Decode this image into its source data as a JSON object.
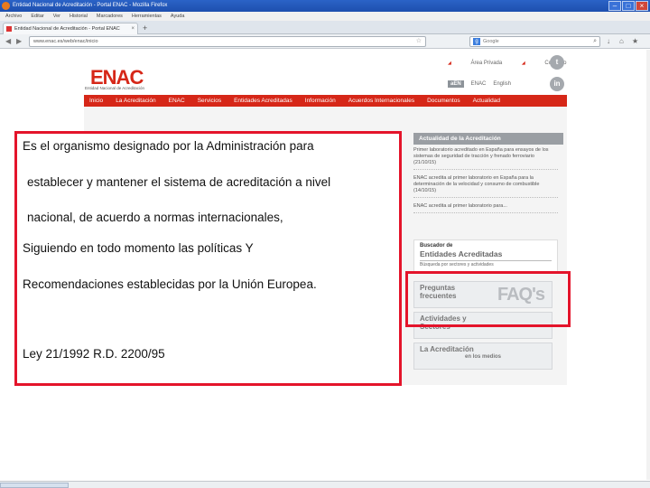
{
  "window": {
    "title": "Entidad Nacional de Acreditación - Portal ENAC - Mozilla Firefox",
    "min": "–",
    "max": "□",
    "close": "×"
  },
  "menubar": {
    "items": [
      "Archivo",
      "Editar",
      "Ver",
      "Historial",
      "Marcadores",
      "Herramientas",
      "Ayuda"
    ]
  },
  "tab": {
    "label": "Entidad Nacional de Acreditación - Portal ENAC",
    "close": "×",
    "new_tab": "+"
  },
  "navbar": {
    "back": "◀",
    "forward": "▶",
    "url": "www.enac.es/web/enac/inicio",
    "search_placeholder": "Google",
    "star": "☆",
    "search_glyph": "⌕"
  },
  "site": {
    "logo": "ENAC",
    "logo_sub": "Entidad Nacional de Acreditación",
    "top_links": [
      "Área Privada",
      "Contacto"
    ],
    "badges": [
      "aEN",
      "ENAC",
      "English"
    ],
    "social": [
      "t",
      "in"
    ],
    "nav": [
      "Inicio",
      "La Acreditación",
      "ENAC",
      "Servicios",
      "Entidades Acreditadas",
      "Información",
      "Acuerdos Internacionales",
      "Documentos",
      "Actualidad"
    ],
    "news_header": "Actualidad de la Acreditación",
    "news": [
      "Primer laboratorio acreditado en España para ensayos de los sistemas de seguridad de tracción y frenado ferroviario (21/10/15)",
      "ENAC acredita al primer laboratorio en España para la determinación de la velocidad y consumo de combustible (14/10/15)",
      "ENAC acredita al primer laboratorio para..."
    ],
    "buscador": {
      "line1": "Buscador de",
      "line2": "Entidades Acreditadas",
      "line3": "Búsqueda por sectores y actividades"
    },
    "banners": [
      {
        "l1": "Preguntas",
        "l2": "frecuentes",
        "side": "FAQ's"
      },
      {
        "l1": "Actividades y",
        "l2": "Sectores",
        "side": ""
      },
      {
        "l1": "La Acreditación",
        "l2": "en los medios",
        "side": ""
      }
    ]
  },
  "overlay_text": {
    "line1": "Es el organismo designado por la Administración para",
    "line2": "establecer y mantener el sistema de acreditación a nivel",
    "line3": "nacional, de acuerdo a normas internacionales,",
    "line4": "Siguiendo  en todo momento las políticas Y",
    "line5": "Recomendaciones establecidas por la Unión Europea.",
    "line6": "Ley 21/1992  R.D. 2200/95"
  },
  "colors": {
    "accent_red": "#d62718",
    "highlight_red": "#e4142b"
  }
}
